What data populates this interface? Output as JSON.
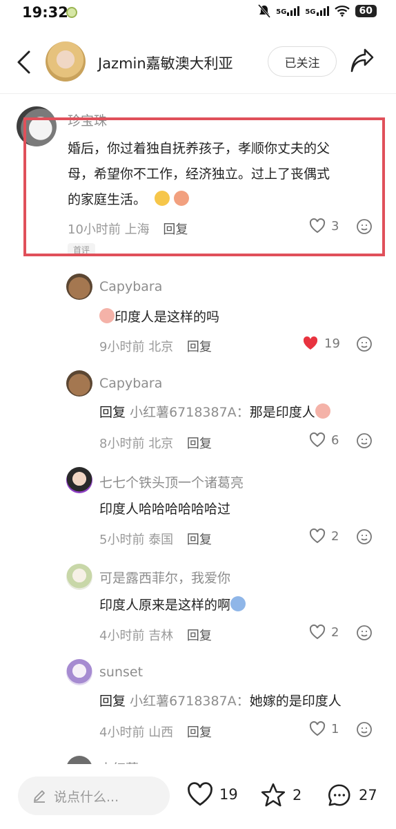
{
  "status_bar": {
    "time": "19:32",
    "network1": "5G",
    "network2": "5G",
    "battery": "60"
  },
  "header": {
    "username": "Jazmin嘉敏澳大利亚",
    "follow_label": "已关注",
    "icons": [
      "back-arrow-icon",
      "share-icon"
    ]
  },
  "main_comment": {
    "author": "珍宝珠",
    "lines": [
      "婚后，你过着独自抚养孩子，孝顺你丈夫的父",
      "母，希望你不工作，经济独立。过上了丧偶式",
      "的家庭生活。"
    ],
    "time": "10小时前",
    "location": "上海",
    "reply_label": "回复",
    "likes": "3",
    "badge": "首评"
  },
  "replies": [
    {
      "author": "Capybara",
      "text": "印度人是这样的吗",
      "time": "9小时前",
      "location": "北京",
      "reply_label": "回复",
      "likes": "19",
      "liked": true
    },
    {
      "author": "Capybara",
      "prefix": "回复",
      "at": "小红薯6718387A：",
      "text": "那是印度人",
      "time": "8小时前",
      "location": "北京",
      "reply_label": "回复",
      "likes": "6",
      "liked": false
    },
    {
      "author": "七七个铁头顶一个诸葛亮",
      "text": "印度人哈哈哈哈哈哈过",
      "time": "5小时前",
      "location": "泰国",
      "reply_label": "回复",
      "likes": "2",
      "liked": false
    },
    {
      "author": "可是露西菲尔，我爱你",
      "text": "印度人原来是这样的啊",
      "time": "4小时前",
      "location": "吉林",
      "reply_label": "回复",
      "likes": "2",
      "liked": false
    },
    {
      "author": "sunset",
      "prefix": "回复",
      "at": "小红薯6718387A：",
      "text": "她嫁的是印度人",
      "time": "4小时前",
      "location": "山西",
      "reply_label": "回复",
      "likes": "1",
      "liked": false
    },
    {
      "author": "小红薯"
    }
  ],
  "bottom_bar": {
    "placeholder": "说点什么...",
    "likes": "19",
    "stars": "2",
    "comments": "27"
  },
  "colors": {
    "highlight_border": "#e0505a",
    "liked_heart": "#e8333f",
    "secondary_text": "#999999"
  }
}
